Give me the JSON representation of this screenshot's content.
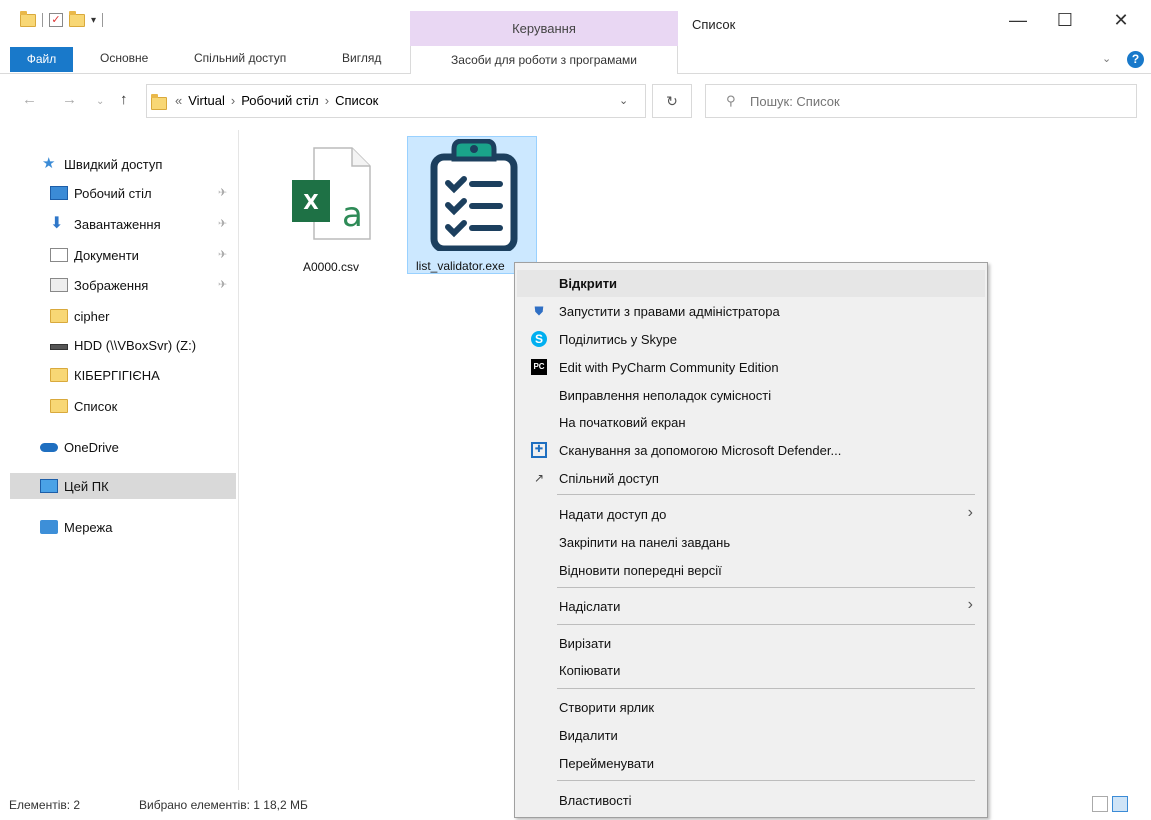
{
  "window": {
    "title": "Список",
    "manage_label": "Керування",
    "minimize": "—",
    "maximize": "☐",
    "close": "✕"
  },
  "ribbon": {
    "file": "Файл",
    "tabs": [
      "Основне",
      "Спільний доступ",
      "Вигляд"
    ],
    "tool_tab": "Засоби для роботи з програмами",
    "help": "?",
    "collapse": "⌄"
  },
  "nav": {
    "back": "←",
    "forward": "→",
    "recent": "⌄",
    "up": "↑",
    "overflow": "«",
    "crumbs": [
      "Virtual",
      "Робочий стіл",
      "Список"
    ],
    "crumb_sep": "›",
    "refresh": "↻",
    "search_placeholder": "Пошук: Список"
  },
  "sidebar": {
    "items": [
      {
        "label": "Швидкий доступ",
        "icon": "star-icon",
        "pinned": false
      },
      {
        "label": "Робочий стіл",
        "icon": "desktop-icon",
        "pinned": true
      },
      {
        "label": "Завантаження",
        "icon": "download-icon",
        "pinned": true
      },
      {
        "label": "Документи",
        "icon": "documents-icon",
        "pinned": true
      },
      {
        "label": "Зображення",
        "icon": "pictures-icon",
        "pinned": true
      },
      {
        "label": "cipher",
        "icon": "folder-icon",
        "pinned": false
      },
      {
        "label": "HDD (\\\\VBoxSvr) (Z:)",
        "icon": "network-drive-icon",
        "pinned": false
      },
      {
        "label": "КІБЕРГІГІЄНА",
        "icon": "folder-icon",
        "pinned": false
      },
      {
        "label": "Список",
        "icon": "folder-icon",
        "pinned": false
      },
      {
        "label": "OneDrive",
        "icon": "onedrive-icon",
        "pinned": false
      },
      {
        "label": "Цей ПК",
        "icon": "this-pc-icon",
        "pinned": false
      },
      {
        "label": "Мережа",
        "icon": "network-icon",
        "pinned": false
      }
    ],
    "pin_glyph": "✈"
  },
  "files": [
    {
      "name": "A0000.csv",
      "icon": "excel-csv-icon"
    },
    {
      "name": "list_validator.exe",
      "icon": "clipboard-checklist-icon"
    }
  ],
  "context_menu": {
    "items": [
      {
        "label": "Відкрити",
        "icon": "",
        "bold": true
      },
      {
        "label": "Запустити з правами адміністратора",
        "icon": "shield-icon"
      },
      {
        "label": "Поділитись у Skype",
        "icon": "skype-icon"
      },
      {
        "label": "Edit with PyCharm Community Edition",
        "icon": "pycharm-icon"
      },
      {
        "label": "Виправлення неполадок сумісності",
        "icon": ""
      },
      {
        "label": "На початковий екран",
        "icon": ""
      },
      {
        "label": "Сканування за допомогою Microsoft Defender...",
        "icon": "defender-icon"
      },
      {
        "label": "Спільний доступ",
        "icon": "share-icon"
      },
      {
        "label": "Надати доступ до",
        "icon": "",
        "submenu": true
      },
      {
        "label": "Закріпити на панелі завдань",
        "icon": ""
      },
      {
        "label": "Відновити попередні версії",
        "icon": ""
      },
      {
        "label": "Надіслати",
        "icon": "",
        "submenu": true
      },
      {
        "label": "Вирізати",
        "icon": ""
      },
      {
        "label": "Копіювати",
        "icon": ""
      },
      {
        "label": "Створити ярлик",
        "icon": ""
      },
      {
        "label": "Видалити",
        "icon": ""
      },
      {
        "label": "Перейменувати",
        "icon": ""
      },
      {
        "label": "Властивості",
        "icon": ""
      }
    ],
    "submenu_arrow": "›"
  },
  "status": {
    "count": "Елементів: 2",
    "selected": "Вибрано елементів: 1  18,2 МБ"
  }
}
